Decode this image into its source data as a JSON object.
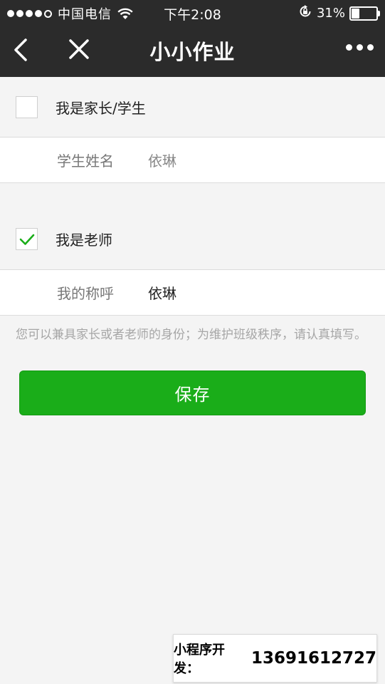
{
  "status_bar": {
    "carrier": "中国电信",
    "time": "下午2:08",
    "battery": "31%",
    "battery_level": 0.31
  },
  "nav": {
    "title": "小小作业",
    "icons": [
      "back-icon",
      "close-icon",
      "more-icon"
    ]
  },
  "form": {
    "parent": {
      "label": "我是家长/学生",
      "checked": false,
      "field_label": "学生姓名",
      "field_value": "依琳"
    },
    "teacher": {
      "label": "我是老师",
      "checked": true,
      "field_label": "我的称呼",
      "field_value": "依琳"
    },
    "hint": "您可以兼具家长或者老师的身份；为维护班级秩序，请认真填写。"
  },
  "actions": {
    "save_label": "保存"
  },
  "footer": {
    "label": "小程序开发：",
    "phone": "13691612727"
  },
  "colors": {
    "nav_bg": "#2b2b2b",
    "accent": "#1aad19",
    "page_bg": "#f4f4f4"
  }
}
